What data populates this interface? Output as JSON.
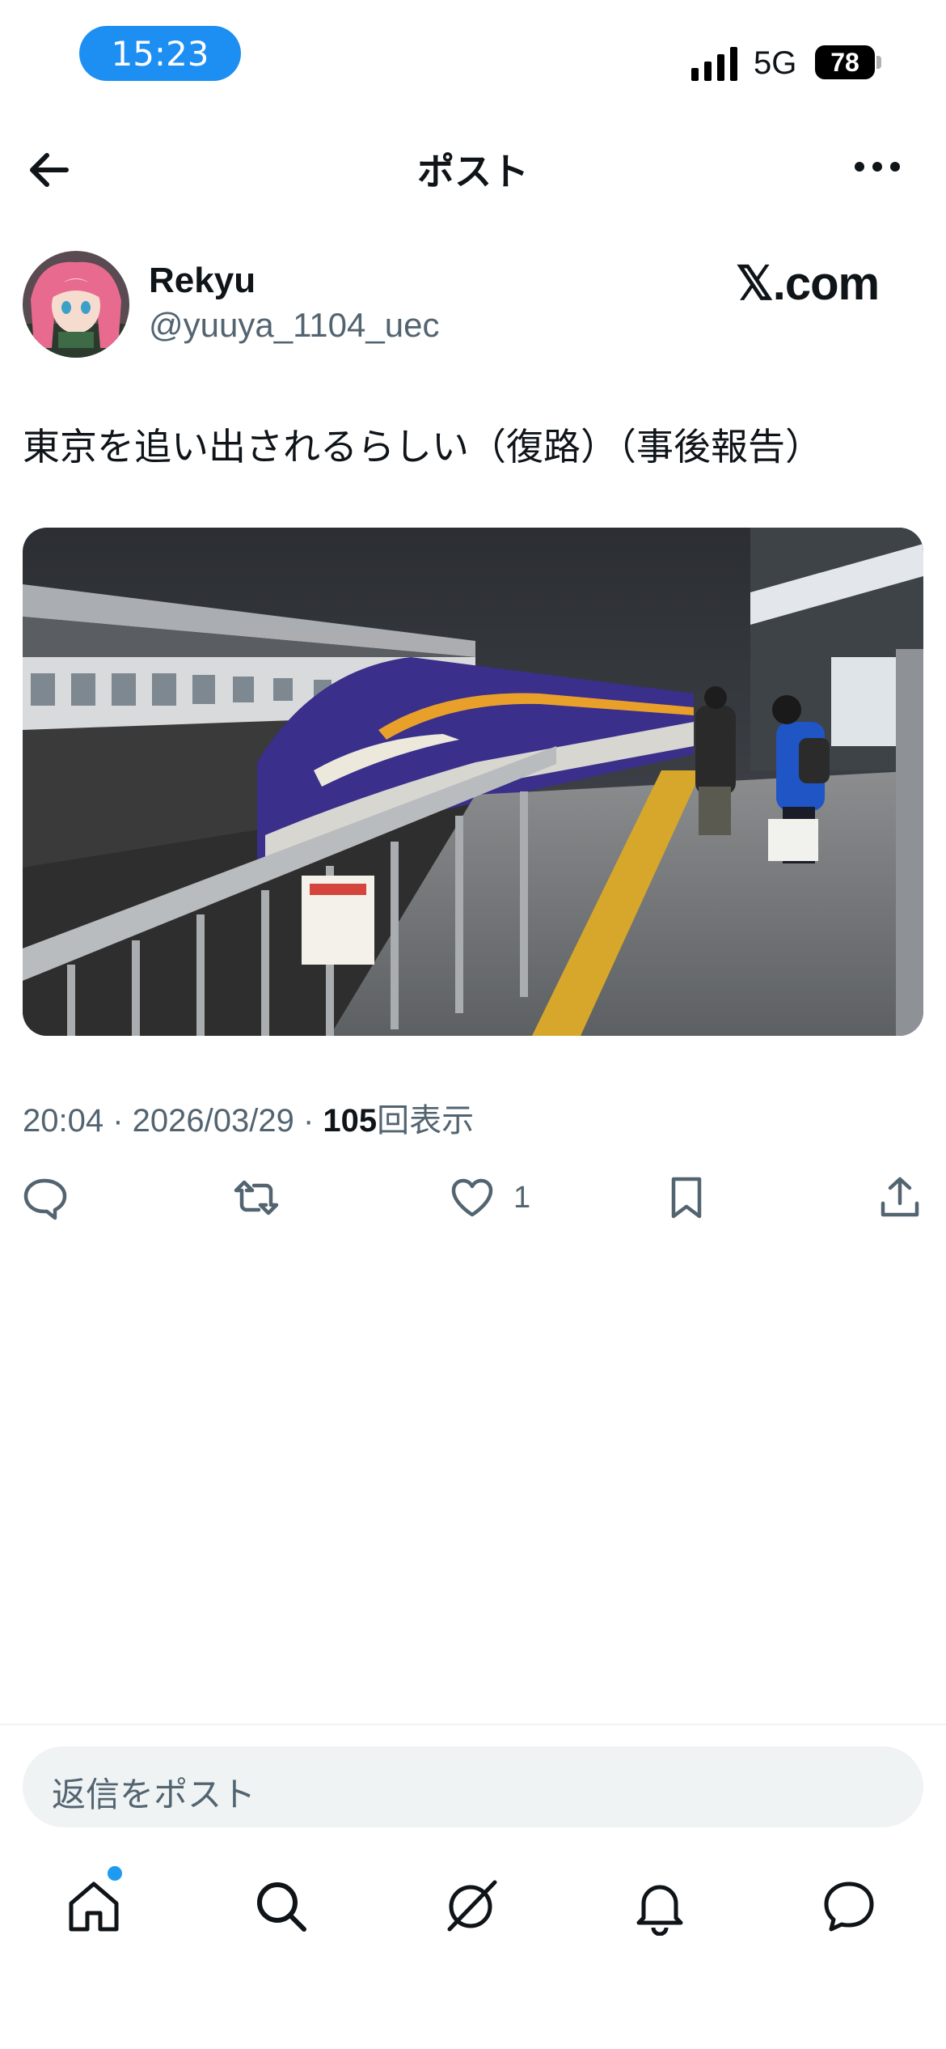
{
  "status_bar": {
    "time": "15:23",
    "network": "5G",
    "battery": "78"
  },
  "header": {
    "title": "ポスト"
  },
  "author": {
    "name": "Rekyu",
    "handle": "@yuuya_1104_uec"
  },
  "watermark": "𝕏.com",
  "post": {
    "text": "東京を追い出されるらしい（復路）（事後報告）",
    "time": "20:04",
    "date": "2026/03/29",
    "views": "105",
    "views_label": "回表示",
    "separator": " · "
  },
  "actions": {
    "like_count": "1"
  },
  "reply": {
    "placeholder": "返信をポスト"
  },
  "colors": {
    "accent": "#1d9bf0",
    "text": "#0f1419",
    "secondary": "#536471",
    "time_pill": "#1d8ff2"
  },
  "icons": {
    "back": "arrow-left-icon",
    "more": "more-dots-icon",
    "reply": "reply-bubble-icon",
    "repost": "repost-icon",
    "like": "heart-icon",
    "bookmark": "bookmark-icon",
    "share": "share-icon",
    "home": "home-icon",
    "search": "search-icon",
    "grok": "grok-icon",
    "notifications": "bell-icon",
    "messages": "message-icon"
  }
}
